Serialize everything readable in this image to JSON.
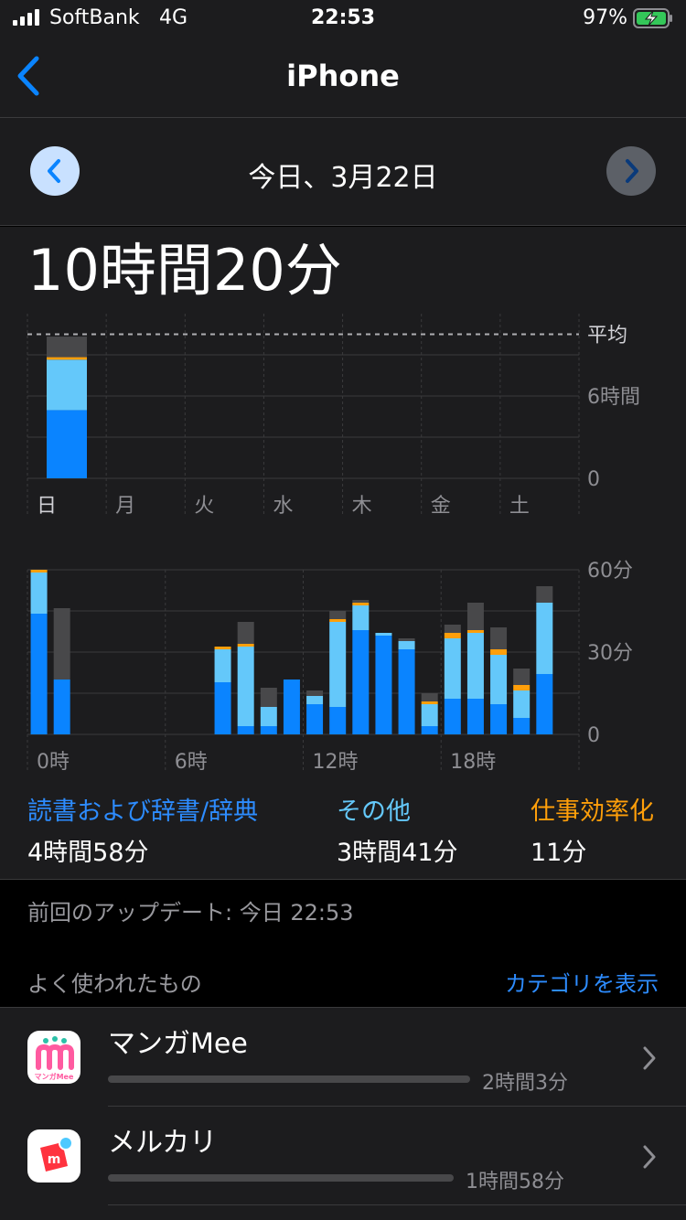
{
  "status": {
    "carrier": "SoftBank",
    "network": "4G",
    "time": "22:53",
    "battery": "97%"
  },
  "nav": {
    "back_icon": "chevron-left-icon",
    "title": "iPhone"
  },
  "day_selector": {
    "date": "今日、3月22日"
  },
  "total_time": "10時間20分",
  "colors": {
    "reading": "#0a84ff",
    "other": "#64c8fa",
    "productivity": "#ff9f0a",
    "uncategorized": "#48484a"
  },
  "chart_data": [
    {
      "type": "bar",
      "title": "",
      "categories": [
        "日",
        "月",
        "火",
        "水",
        "木",
        "金",
        "土"
      ],
      "y_ticks": [
        "0",
        "6時間"
      ],
      "average_label": "平均",
      "average_hours": 10.5,
      "ylim": [
        0,
        12
      ],
      "series": [
        {
          "name": "読書および辞書/辞典",
          "values": [
            4.97,
            0,
            0,
            0,
            0,
            0,
            0
          ]
        },
        {
          "name": "その他",
          "values": [
            3.68,
            0,
            0,
            0,
            0,
            0,
            0
          ]
        },
        {
          "name": "仕事効率化",
          "values": [
            0.18,
            0,
            0,
            0,
            0,
            0,
            0
          ]
        },
        {
          "name": "",
          "values": [
            1.5,
            0,
            0,
            0,
            0,
            0,
            0
          ]
        }
      ],
      "stacked": true
    },
    {
      "type": "bar",
      "title": "",
      "x_ticks": [
        "0時",
        "6時",
        "12時",
        "18時"
      ],
      "y_ticks": [
        "0",
        "30分",
        "60分"
      ],
      "ylim": [
        0,
        60
      ],
      "categories": [
        0,
        1,
        2,
        3,
        4,
        5,
        6,
        7,
        8,
        9,
        10,
        11,
        12,
        13,
        14,
        15,
        16,
        17,
        18,
        19,
        20,
        21,
        22,
        23
      ],
      "series": [
        {
          "name": "読書および辞書/辞典",
          "values": [
            44,
            20,
            0,
            0,
            0,
            0,
            0,
            0,
            19,
            3,
            3,
            20,
            11,
            10,
            38,
            36,
            31,
            3,
            13,
            13,
            11,
            6,
            22,
            0
          ]
        },
        {
          "name": "その他",
          "values": [
            15,
            0,
            0,
            0,
            0,
            0,
            0,
            0,
            12,
            29,
            7,
            0,
            3,
            31,
            9,
            1,
            3,
            8,
            22,
            24,
            18,
            10,
            26,
            0
          ]
        },
        {
          "name": "仕事効率化",
          "values": [
            1,
            0,
            0,
            0,
            0,
            0,
            0,
            0,
            1,
            1,
            0,
            0,
            0,
            1,
            1,
            0,
            0,
            1,
            2,
            1,
            2,
            2,
            0,
            0
          ]
        },
        {
          "name": "",
          "values": [
            0,
            26,
            0,
            0,
            0,
            0,
            0,
            0,
            0,
            8,
            7,
            0,
            2,
            3,
            1,
            0,
            1,
            3,
            3,
            10,
            8,
            6,
            6,
            0
          ]
        }
      ],
      "stacked": true
    }
  ],
  "legend": [
    {
      "category": "読書および辞書/辞典",
      "value": "4時間58分"
    },
    {
      "category": "その他",
      "value": "3時間41分"
    },
    {
      "category": "仕事効率化",
      "value": "11分"
    }
  ],
  "updated": "前回のアップデート: 今日 22:53",
  "most_used": {
    "label": "よく使われたもの",
    "show_categories": "カテゴリを表示",
    "apps": [
      {
        "name": "マンガMee",
        "duration": "2時間3分",
        "icon": "mangamee-icon",
        "icon_text": "マンガMee",
        "minutes": 123
      },
      {
        "name": "メルカリ",
        "duration": "1時間58分",
        "icon": "mercari-icon",
        "icon_text": "m",
        "minutes": 118
      }
    ]
  }
}
